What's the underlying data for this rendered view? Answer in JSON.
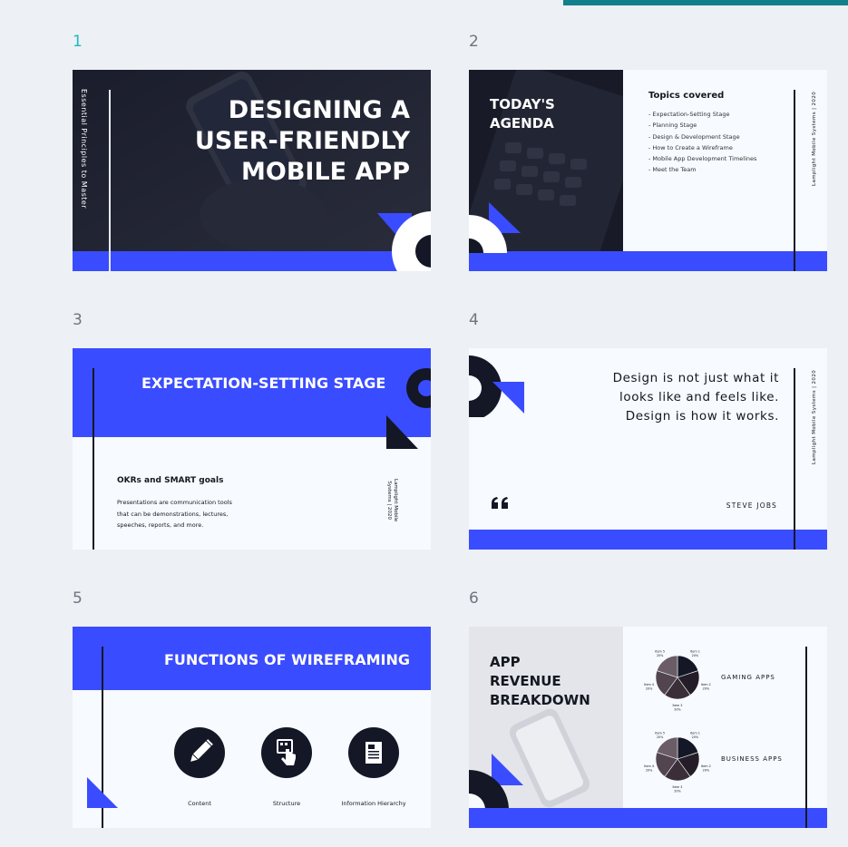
{
  "colors": {
    "background": "#edf0f4",
    "accent": "#3a4cff",
    "dark": "#131726",
    "active_number": "#1db8c4",
    "top_bar": "#12808a"
  },
  "slides": [
    {
      "number": "1",
      "title_lines": [
        "DESIGNING A",
        "USER-FRIENDLY",
        "MOBILE APP"
      ],
      "side_text": "Essential Principles to Master"
    },
    {
      "number": "2",
      "title_lines": [
        "TODAY'S",
        "AGENDA"
      ],
      "topics_heading": "Topics covered",
      "topics": [
        "- Expectation-Setting Stage",
        "- Planning Stage",
        "- Design & Development Stage",
        "- How to Create a Wireframe",
        "- Mobile App Development Timelines",
        "- Meet the Team"
      ],
      "footer": "Lamplight Mobile Systems | 2020"
    },
    {
      "number": "3",
      "title": "EXPECTATION-SETTING STAGE",
      "subtitle": "OKRs and SMART goals",
      "body_lines": [
        "Presentations are communication tools",
        "that can be demonstrations, lectures,",
        "speeches, reports, and more."
      ],
      "footer_lines": [
        "Lamplight Mobile",
        "Systems | 2020"
      ]
    },
    {
      "number": "4",
      "quote_lines": [
        "Design is not just what it",
        "looks like and feels like.",
        "Design is how it works."
      ],
      "quote_mark": "66",
      "author": "STEVE JOBS",
      "footer": "Lamplight Mobile Systems | 2020"
    },
    {
      "number": "5",
      "title": "FUNCTIONS OF WIREFRAMING",
      "items": [
        {
          "label": "Content",
          "icon": "pencil-icon"
        },
        {
          "label": "Structure",
          "icon": "touch-screen-icon"
        },
        {
          "label": "Information Hierarchy",
          "icon": "document-icon"
        }
      ]
    },
    {
      "number": "6",
      "title_lines": [
        "APP",
        "REVENUE",
        "BREAKDOWN"
      ],
      "charts": [
        {
          "label": "GAMING APPS"
        },
        {
          "label": "BUSINESS APPS"
        }
      ]
    }
  ],
  "chart_data": [
    {
      "type": "pie",
      "title": "GAMING APPS",
      "categories": [
        "Item 1",
        "Item 2",
        "Item 3",
        "Item 4",
        "Item 5"
      ],
      "values": [
        20,
        20,
        20,
        20,
        20
      ],
      "data_labels": [
        "20%",
        "20%",
        "20%",
        "20%",
        "20%"
      ]
    },
    {
      "type": "pie",
      "title": "BUSINESS APPS",
      "categories": [
        "Item 1",
        "Item 2",
        "Item 3",
        "Item 4",
        "Item 5"
      ],
      "values": [
        20,
        20,
        20,
        20,
        20
      ],
      "data_labels": [
        "20%",
        "20%",
        "20%",
        "20%",
        "20%"
      ]
    }
  ]
}
